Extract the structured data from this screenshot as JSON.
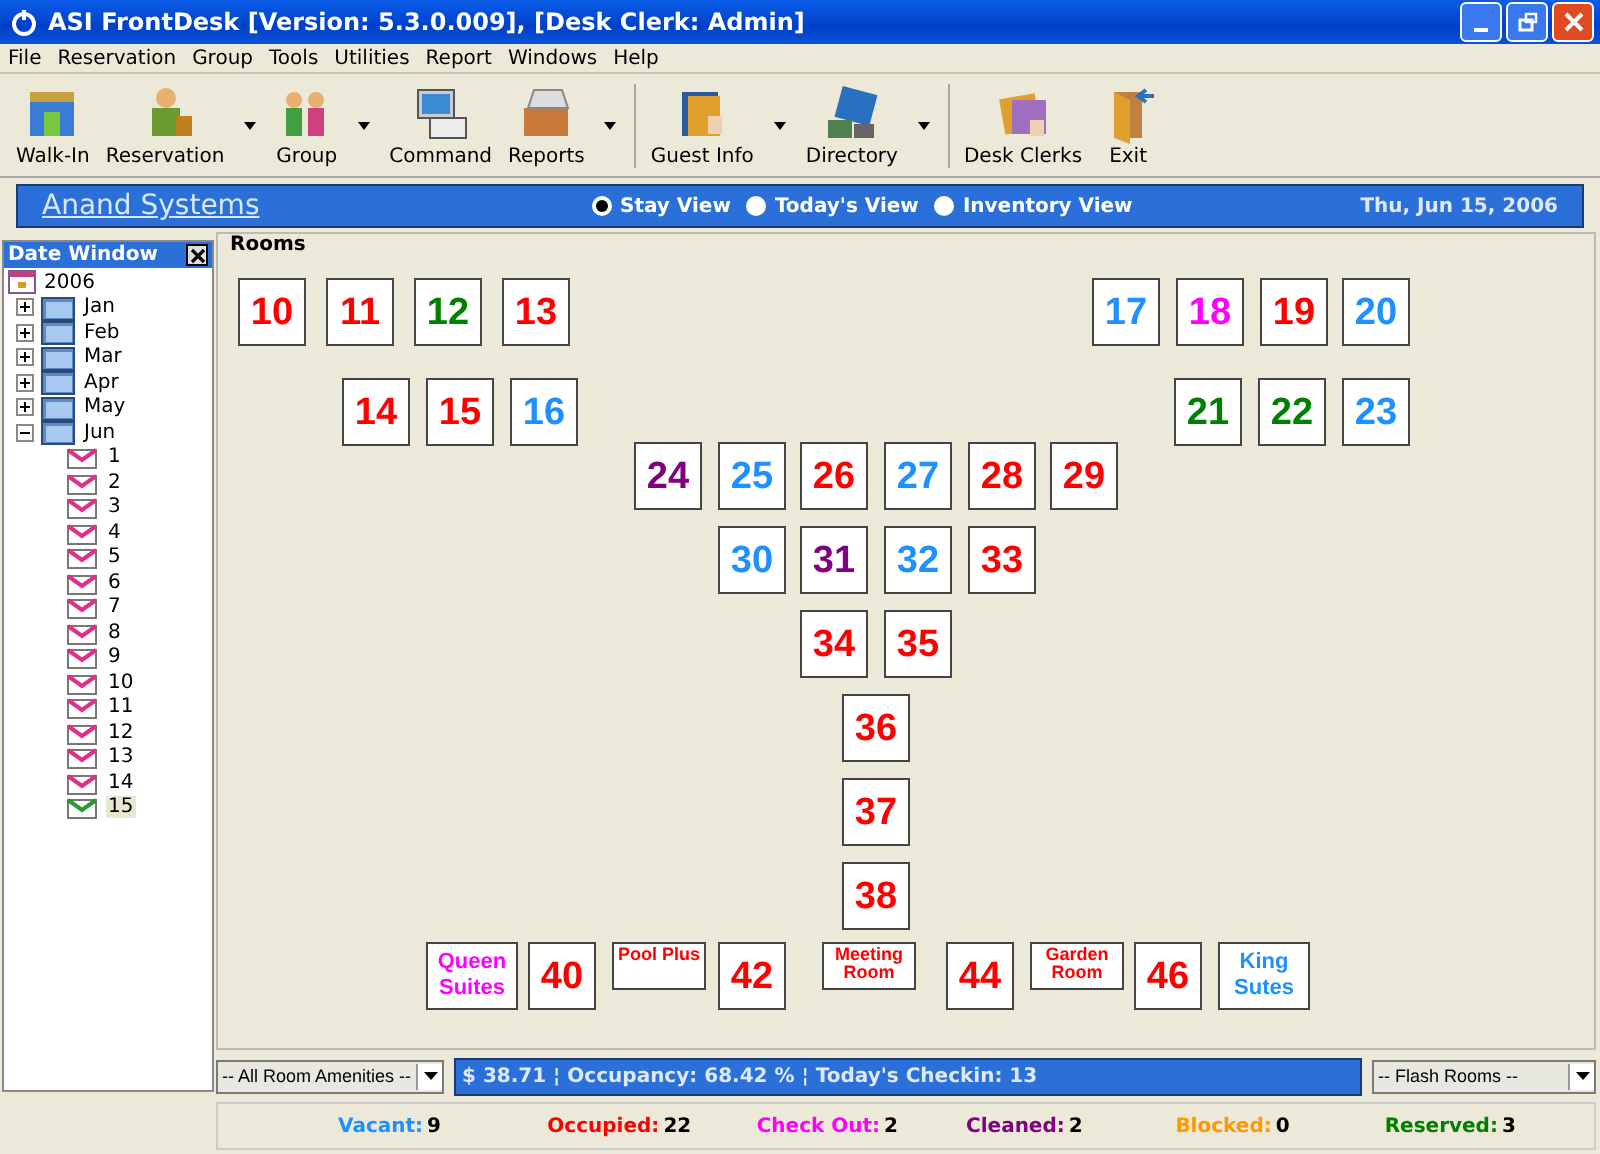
{
  "window": {
    "title": "ASI FrontDesk [Version: 5.3.0.009], [Desk Clerk: Admin]"
  },
  "menu": [
    "File",
    "Reservation",
    "Group",
    "Tools",
    "Utilities",
    "Report",
    "Windows",
    "Help"
  ],
  "toolbar": [
    {
      "label": "Walk-In",
      "dropdown": false
    },
    {
      "label": "Reservation",
      "dropdown": true
    },
    {
      "label": "Group",
      "dropdown": true
    },
    {
      "label": "Command",
      "dropdown": false
    },
    {
      "label": "Reports",
      "dropdown": true
    },
    {
      "label": "Guest Info",
      "dropdown": true
    },
    {
      "label": "Directory",
      "dropdown": true
    },
    {
      "label": "Desk Clerks",
      "dropdown": false
    },
    {
      "label": "Exit",
      "dropdown": false
    }
  ],
  "banner": {
    "company": "Anand Systems",
    "views": [
      {
        "label": "Stay View",
        "selected": true
      },
      {
        "label": "Today's View",
        "selected": false
      },
      {
        "label": "Inventory View",
        "selected": false
      }
    ],
    "date": "Thu, Jun 15, 2006"
  },
  "date_window": {
    "title": "Date Window",
    "tree": [
      {
        "label": "2006",
        "children": [
          {
            "label": "Jan",
            "expanded": false
          },
          {
            "label": "Feb",
            "expanded": false
          },
          {
            "label": "Mar",
            "expanded": false
          },
          {
            "label": "Apr",
            "expanded": false
          },
          {
            "label": "May",
            "expanded": false
          },
          {
            "label": "Jun",
            "expanded": true,
            "children": [
              {
                "label": "1",
                "selected": false
              },
              {
                "label": "2",
                "selected": false
              },
              {
                "label": "3",
                "selected": false
              },
              {
                "label": "4",
                "selected": false
              },
              {
                "label": "5",
                "selected": false
              },
              {
                "label": "6",
                "selected": false
              },
              {
                "label": "7",
                "selected": false
              },
              {
                "label": "8",
                "selected": false
              },
              {
                "label": "9",
                "selected": false
              },
              {
                "label": "10",
                "selected": false
              },
              {
                "label": "11",
                "selected": false
              },
              {
                "label": "12",
                "selected": false
              },
              {
                "label": "13",
                "selected": false
              },
              {
                "label": "14",
                "selected": false
              },
              {
                "label": "15",
                "selected": true
              }
            ]
          }
        ]
      }
    ]
  },
  "rooms_panel": {
    "title": "Rooms",
    "rooms": [
      {
        "label": "10",
        "kind": "room",
        "color": "#ff0000"
      },
      {
        "label": "11",
        "kind": "room",
        "color": "#ff0000"
      },
      {
        "label": "12",
        "kind": "room",
        "color": "#008000"
      },
      {
        "label": "13",
        "kind": "room",
        "color": "#ff0000"
      },
      {
        "label": "17",
        "kind": "room",
        "color": "#1e90ff"
      },
      {
        "label": "18",
        "kind": "room",
        "color": "#ff00ff"
      },
      {
        "label": "19",
        "kind": "room",
        "color": "#ff0000"
      },
      {
        "label": "20",
        "kind": "room",
        "color": "#1e90ff"
      },
      {
        "label": "14",
        "kind": "room",
        "color": "#ff0000"
      },
      {
        "label": "15",
        "kind": "room",
        "color": "#ff0000"
      },
      {
        "label": "16",
        "kind": "room",
        "color": "#1e90ff"
      },
      {
        "label": "21",
        "kind": "room",
        "color": "#008000"
      },
      {
        "label": "22",
        "kind": "room",
        "color": "#008000"
      },
      {
        "label": "23",
        "kind": "room",
        "color": "#1e90ff"
      },
      {
        "label": "24",
        "kind": "room",
        "color": "#800080"
      },
      {
        "label": "25",
        "kind": "room",
        "color": "#1e90ff"
      },
      {
        "label": "26",
        "kind": "room",
        "color": "#ff0000"
      },
      {
        "label": "27",
        "kind": "room",
        "color": "#1e90ff"
      },
      {
        "label": "28",
        "kind": "room",
        "color": "#ff0000"
      },
      {
        "label": "29",
        "kind": "room",
        "color": "#ff0000"
      },
      {
        "label": "30",
        "kind": "room",
        "color": "#1e90ff"
      },
      {
        "label": "31",
        "kind": "room",
        "color": "#800080"
      },
      {
        "label": "32",
        "kind": "room",
        "color": "#1e90ff"
      },
      {
        "label": "33",
        "kind": "room",
        "color": "#ff0000"
      },
      {
        "label": "34",
        "kind": "room",
        "color": "#ff0000"
      },
      {
        "label": "35",
        "kind": "room",
        "color": "#ff0000"
      },
      {
        "label": "36",
        "kind": "room",
        "color": "#ff0000"
      },
      {
        "label": "37",
        "kind": "room",
        "color": "#ff0000"
      },
      {
        "label": "38",
        "kind": "room",
        "color": "#ff0000"
      },
      {
        "label": "Queen Suites",
        "kind": "suite",
        "color": "#ff00ff"
      },
      {
        "label": "40",
        "kind": "room",
        "color": "#ff0000"
      },
      {
        "label": "Pool Plus",
        "kind": "hall",
        "color": "#ff0000"
      },
      {
        "label": "42",
        "kind": "room",
        "color": "#ff0000"
      },
      {
        "label": "Meeting Room",
        "kind": "hall",
        "color": "#ff0000"
      },
      {
        "label": "44",
        "kind": "room",
        "color": "#ff0000"
      },
      {
        "label": "Garden Room",
        "kind": "hall",
        "color": "#ff0000"
      },
      {
        "label": "46",
        "kind": "room",
        "color": "#ff0000"
      },
      {
        "label": "King Sutes",
        "kind": "suite",
        "color": "#1e90ff"
      }
    ]
  },
  "amenities_dropdown": {
    "value": "-- All Room Amenities --"
  },
  "summary": "$ 38.71 ¦ Occupancy: 68.42 % ¦ Today's Checkin: 13",
  "flash_dropdown": {
    "value": "-- Flash Rooms --"
  },
  "status_counts": [
    {
      "label": "Vacant:",
      "count": "9",
      "color": "#1e90ff"
    },
    {
      "label": "Occupied:",
      "count": "22",
      "color": "#ff0000"
    },
    {
      "label": "Check Out:",
      "count": "2",
      "color": "#ff00ff"
    },
    {
      "label": "Cleaned:",
      "count": "2",
      "color": "#800080"
    },
    {
      "label": "Blocked:",
      "count": "0",
      "color": "#ff9900"
    },
    {
      "label": "Reserved:",
      "count": "3",
      "color": "#008000"
    }
  ]
}
